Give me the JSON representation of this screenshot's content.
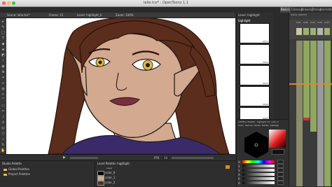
{
  "window": {
    "title": "lalie.tnz* : OpenToonz 1.1",
    "rooms": [
      "Basics",
      "Cleanup",
      "Drawing",
      "Timing",
      "Animation"
    ],
    "active_room": "Basics"
  },
  "viewer": {
    "header": {
      "scene": "Scene: lalie.tnz*",
      "frame": "Frame: 15",
      "level": "Level: highlight_0",
      "zoom": "Zoom: 100%"
    },
    "bottom_bar": {
      "fps_label": "FPS",
      "fps_value": "24"
    }
  },
  "level_strip": {
    "title": "Level: highlight",
    "level_name": "highlight",
    "frames": [
      "0001",
      "0002",
      "0003",
      "0004",
      "0005"
    ]
  },
  "style_editor": {
    "title": "[LEVEL]: Palette : highlight (1): color_1",
    "tabs": [
      "Color",
      "Texture",
      "Vector",
      "Raster",
      "Settings"
    ],
    "channel_labels": [
      "H",
      "S",
      "V",
      "A",
      "R",
      "G",
      "B"
    ]
  },
  "xsheet": {
    "header": "Scene: lalie.tnz",
    "columns": [
      "Col1",
      "Col2",
      "Col3",
      "Col4",
      "Col5"
    ]
  },
  "studio_palette": {
    "title": "Studio Palette",
    "items": [
      "Global Palettes",
      "Project Palettes"
    ]
  },
  "level_palette": {
    "title": "Level Palette: highlight",
    "tab": "Level",
    "styles": [
      "color_0",
      "color_1",
      "color_2"
    ]
  },
  "colors": {
    "accent": "#d98a2a",
    "skin": "#d3a98f",
    "hair": "#5b2d1c",
    "eye": "#e3b63c",
    "lip": "#7a2e3c",
    "shirt": "#3a2a6a",
    "folder": "#e6b54a"
  },
  "icons": [
    "close-icon",
    "minimize-icon",
    "maximize-icon",
    "selection-tool-icon",
    "brush-tool-icon",
    "eraser-tool-icon",
    "play-icon",
    "folder-icon"
  ]
}
